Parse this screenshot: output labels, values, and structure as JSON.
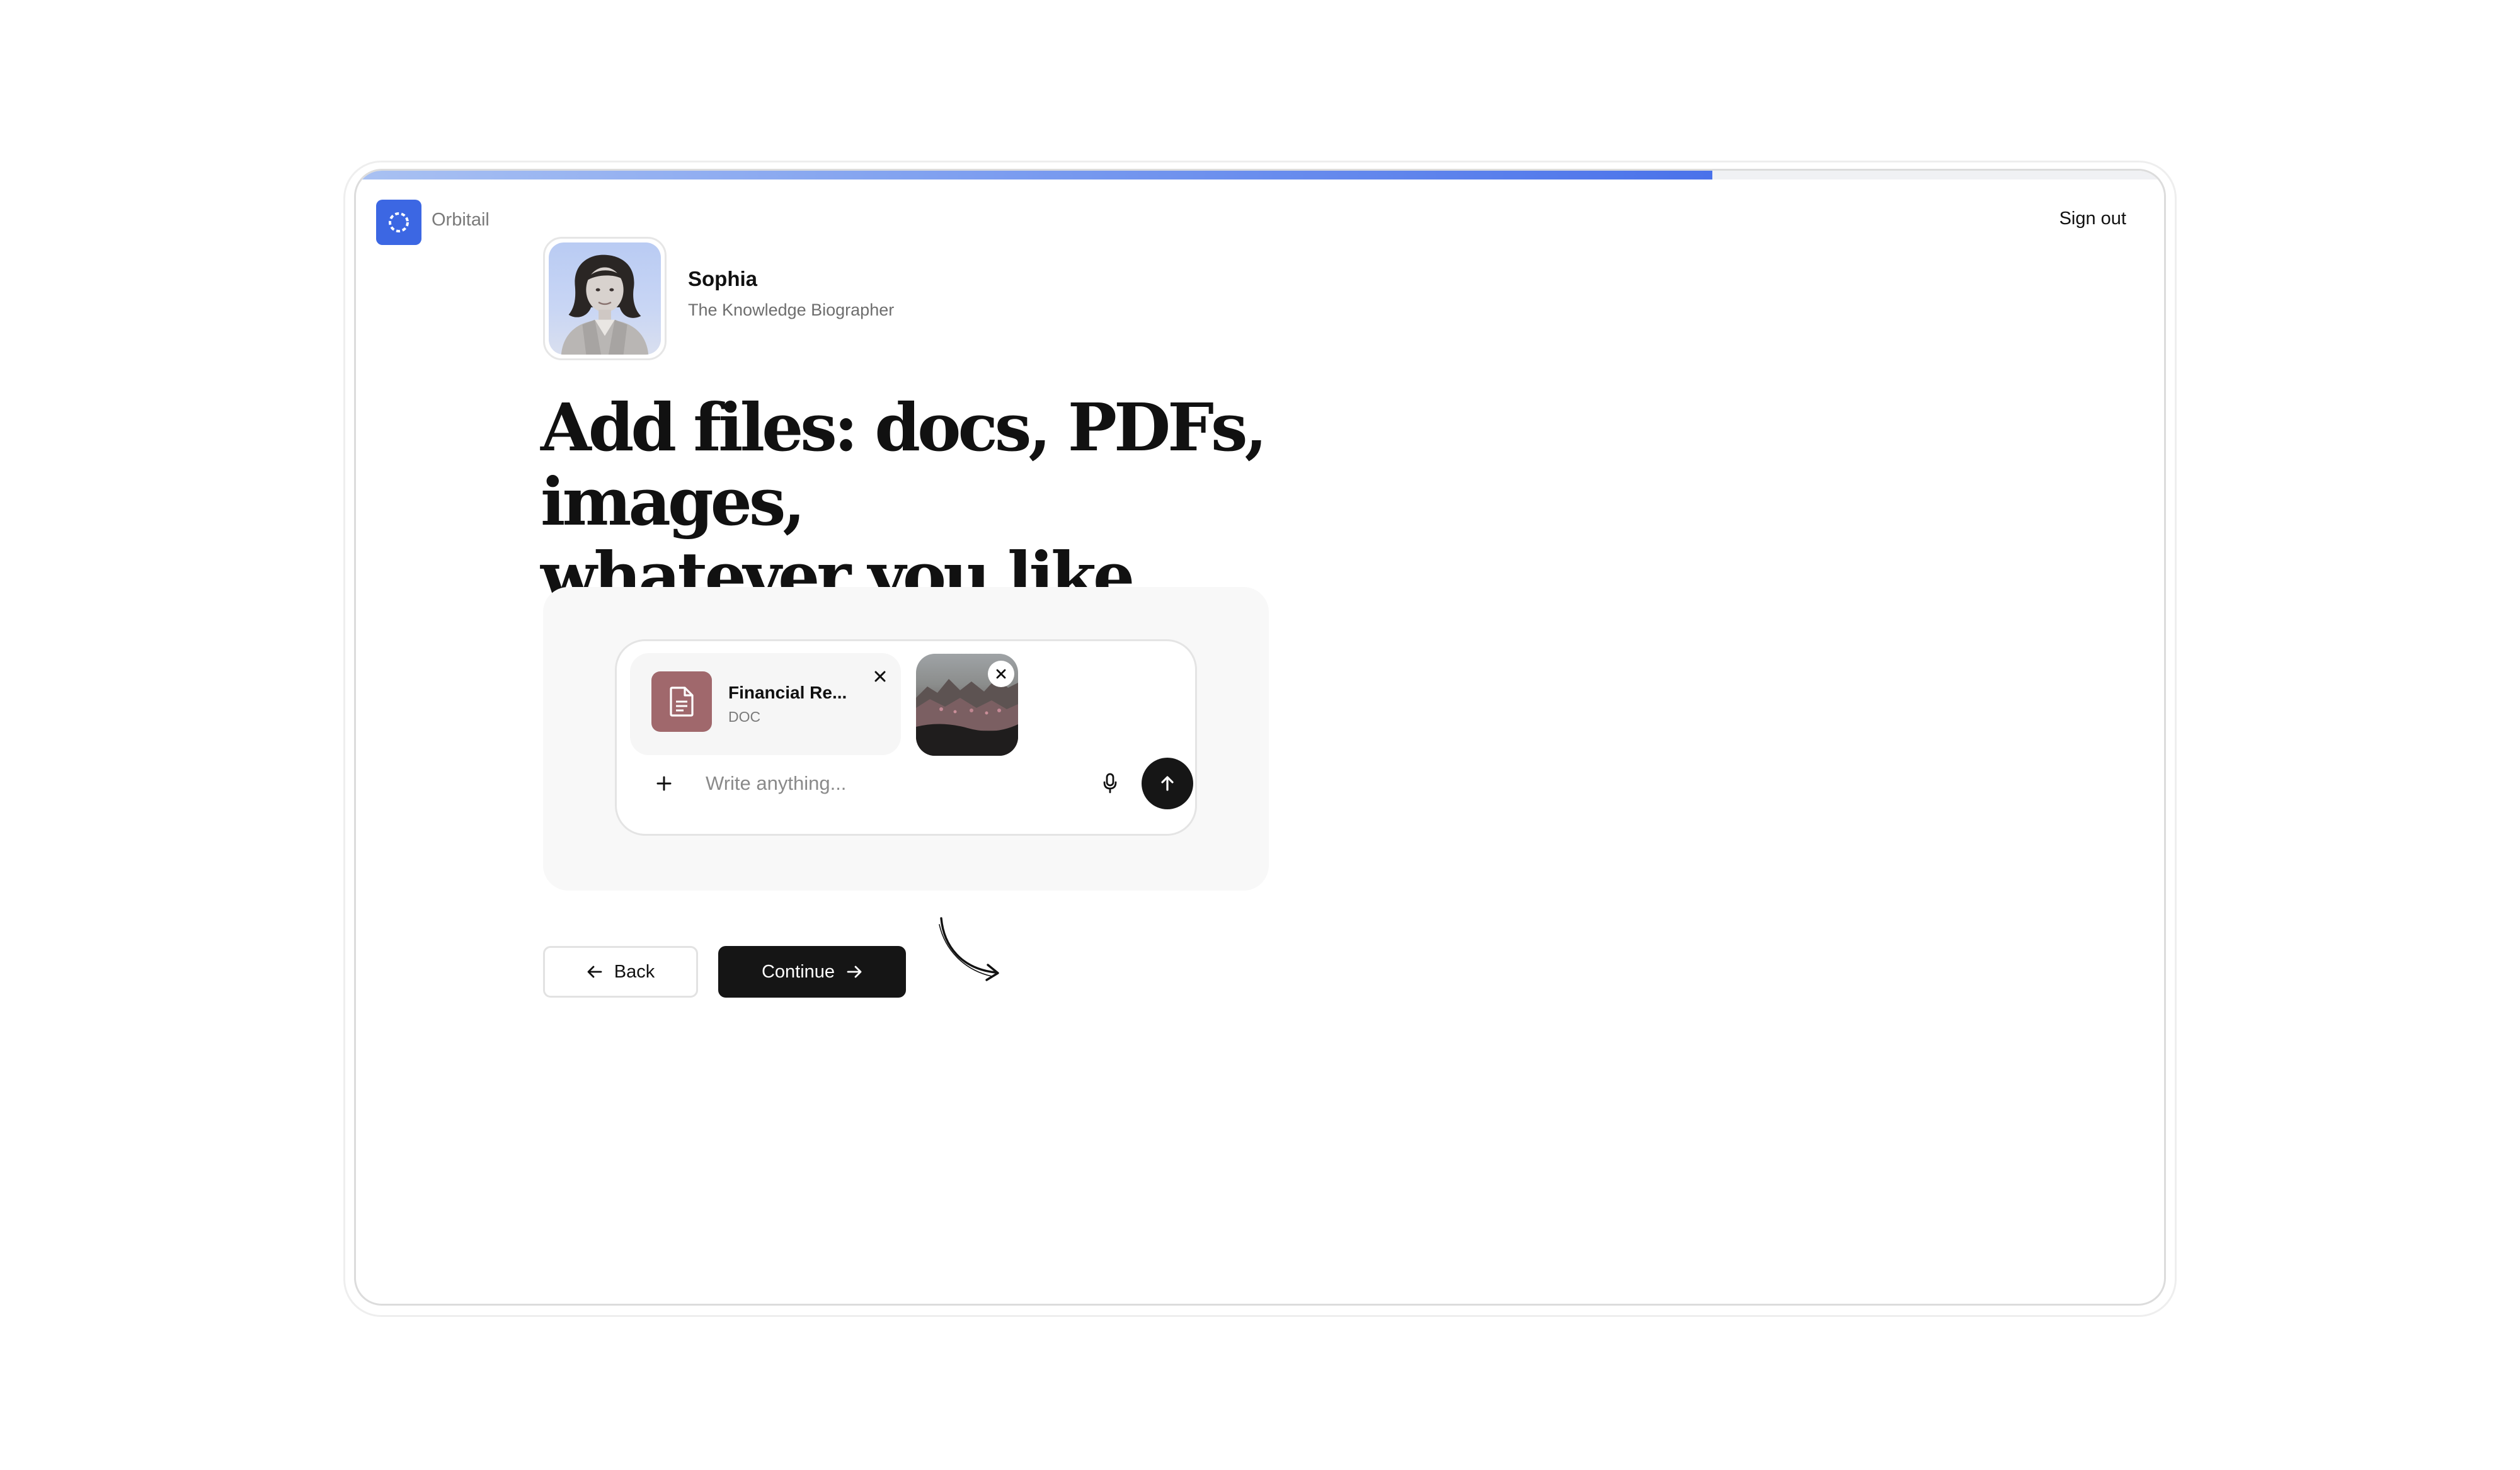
{
  "header": {
    "app_name": "Orbitail",
    "sign_out_label": "Sign out",
    "progress": 0.75
  },
  "agent": {
    "name": "Sophia",
    "role": "The Knowledge Biographer"
  },
  "headline": {
    "line1": "Add files: docs, PDFs, images,",
    "line2": "whatever you like."
  },
  "composer": {
    "file": {
      "name": "Financial Re...",
      "type": "DOC"
    },
    "input_placeholder": "Write anything...",
    "icons": {
      "add": "plus-icon",
      "mic": "microphone-icon",
      "send": "arrow-up-icon",
      "remove": "close-icon"
    }
  },
  "actions": {
    "back_label": "Back",
    "continue_label": "Continue"
  },
  "colors": {
    "brand": "#3c67e3",
    "file_icon_bg": "#a0686c",
    "primary_button": "#151515"
  }
}
